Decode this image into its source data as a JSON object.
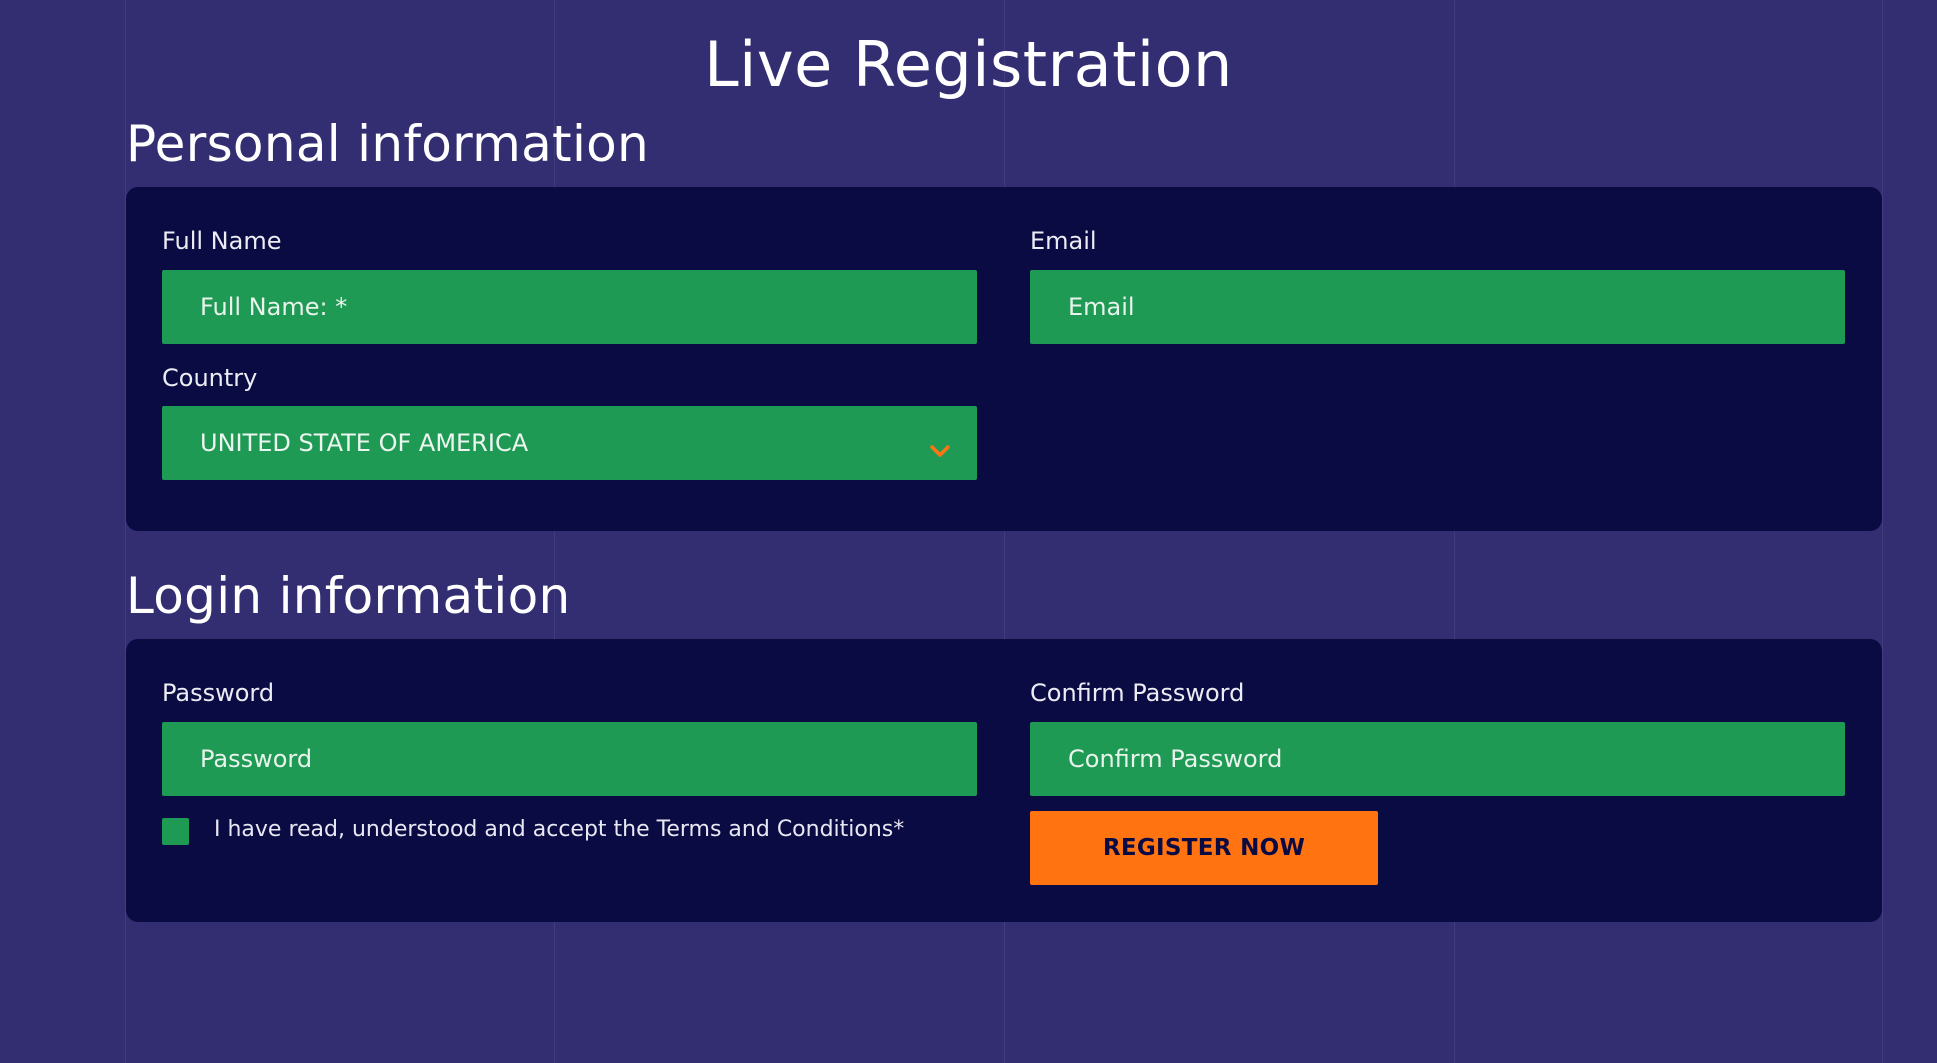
{
  "page": {
    "title": "Live Registration"
  },
  "personal": {
    "heading": "Personal information",
    "full_name": {
      "label": "Full Name",
      "placeholder": "Full Name: *",
      "value": ""
    },
    "email": {
      "label": "Email",
      "placeholder": "Email",
      "value": ""
    },
    "country": {
      "label": "Country",
      "selected": "UNITED STATE OF AMERICA",
      "icon": "chevron-down-icon"
    }
  },
  "login": {
    "heading": "Login information",
    "password": {
      "label": "Password",
      "placeholder": "Password",
      "value": ""
    },
    "confirm_password": {
      "label": "Confirm Password",
      "placeholder": "Confirm Password",
      "value": ""
    },
    "terms": {
      "text": "I have read, understood and accept the Terms and Conditions*",
      "checked": false
    },
    "register_label": "REGISTER NOW"
  },
  "colors": {
    "background": "#332e72",
    "panel": "#0b0b44",
    "field": "#1f9a55",
    "accent": "#ff7411"
  }
}
